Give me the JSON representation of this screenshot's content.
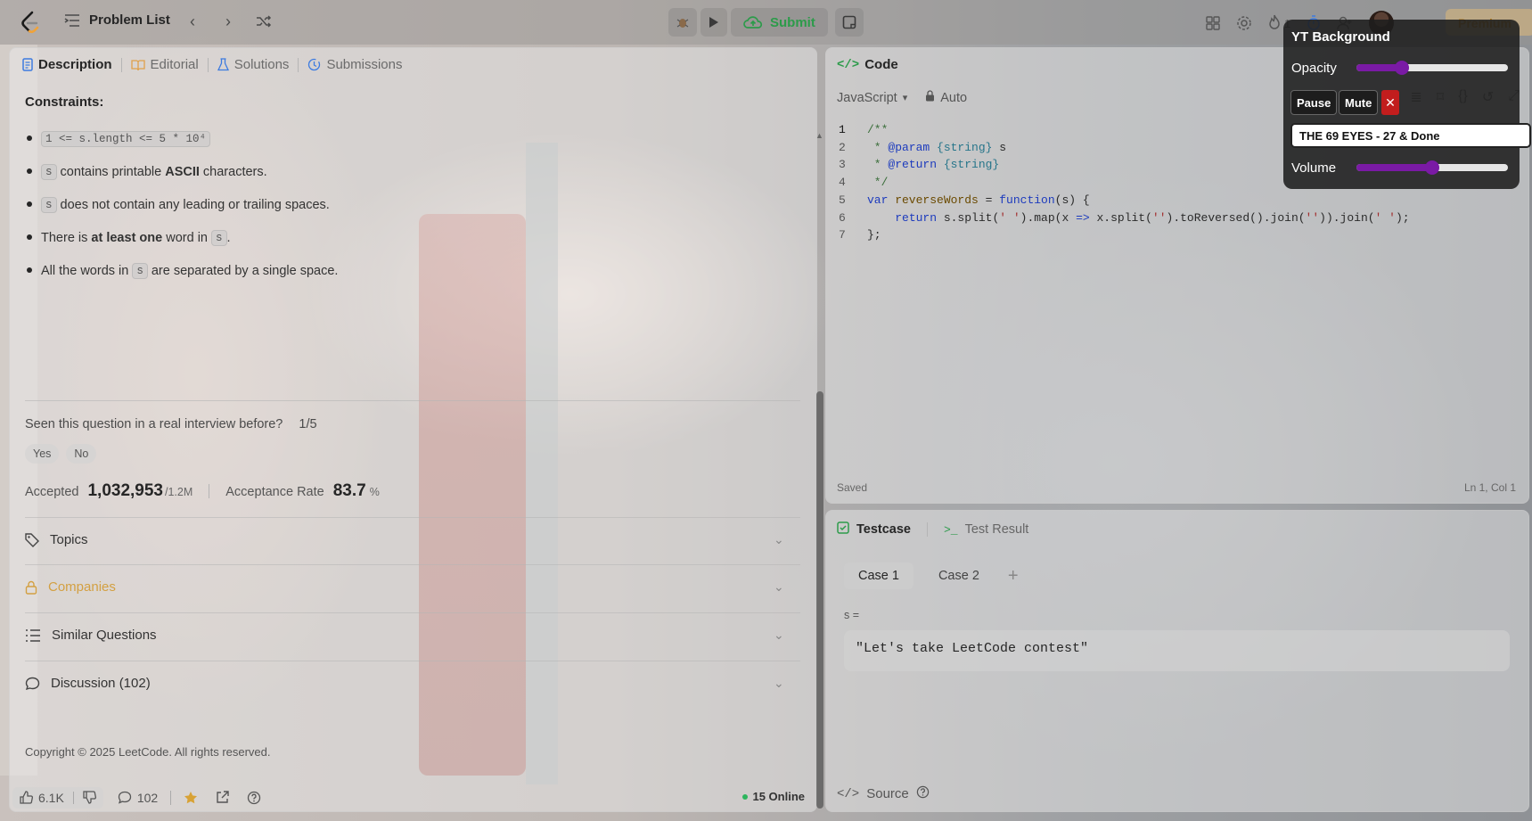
{
  "topbar": {
    "problem_list": "Problem List",
    "submit": "Submit",
    "streak": "1",
    "premium": "Premium"
  },
  "left": {
    "tabs": [
      {
        "label": "Description",
        "icon": "description-icon"
      },
      {
        "label": "Editorial",
        "icon": "book-icon"
      },
      {
        "label": "Solutions",
        "icon": "flask-icon"
      },
      {
        "label": "Submissions",
        "icon": "history-icon"
      }
    ],
    "constraints_title": "Constraints:",
    "constraints": [
      {
        "code": "1 <= s.length <= 5 * 10⁴"
      },
      {
        "code": "s",
        "text_a": "contains printable",
        "bold": "ASCII",
        "text_b": "characters."
      },
      {
        "code": "s",
        "text": "does not contain any leading or trailing spaces."
      },
      {
        "pre": "There is",
        "bold": "at least one",
        "mid": "word in",
        "code": "s",
        "post": "."
      },
      {
        "pre": "All the words in",
        "code": "s",
        "post": "are separated by a single space."
      }
    ],
    "interview_q": "Seen this question in a real interview before?",
    "interview_count": "1/5",
    "yes": "Yes",
    "no": "No",
    "accepted_label": "Accepted",
    "accepted_value": "1,032,953",
    "accepted_total": "/1.2M",
    "rate_label": "Acceptance Rate",
    "rate_value": "83.7",
    "rate_unit": "%",
    "accordions": [
      {
        "label": "Topics",
        "icon": "tag-icon"
      },
      {
        "label": "Companies",
        "icon": "lock-icon"
      },
      {
        "label": "Similar Questions",
        "icon": "list-icon"
      },
      {
        "label": "Discussion (102)",
        "icon": "comment-icon"
      }
    ],
    "copyright": "Copyright © 2025 LeetCode. All rights reserved.",
    "likes": "6.1K",
    "comments": "102",
    "online": "15 Online"
  },
  "code": {
    "header": "Code",
    "language": "JavaScript",
    "mode": "Auto",
    "lines": [
      "1",
      "2",
      "3",
      "4",
      "5",
      "6",
      "7"
    ],
    "saved": "Saved",
    "cursor": "Ln 1, Col 1"
  },
  "test": {
    "tab_testcase": "Testcase",
    "tab_result": "Test Result",
    "cases": [
      "Case 1",
      "Case 2"
    ],
    "var_label": "s =",
    "var_value": "\"Let's take LeetCode contest\"",
    "source": "Source"
  },
  "yt": {
    "title": "YT Background",
    "opacity_label": "Opacity",
    "opacity_value": 0.3,
    "pause": "Pause",
    "mute": "Mute",
    "close": "✕",
    "track": "THE 69 EYES - 27 & Done",
    "volume_label": "Volume",
    "volume_value": 0.5
  },
  "colors": {
    "accent_green": "#2c9b4a",
    "yt_purple": "#7a1aa5",
    "premium": "#b07a1d"
  }
}
